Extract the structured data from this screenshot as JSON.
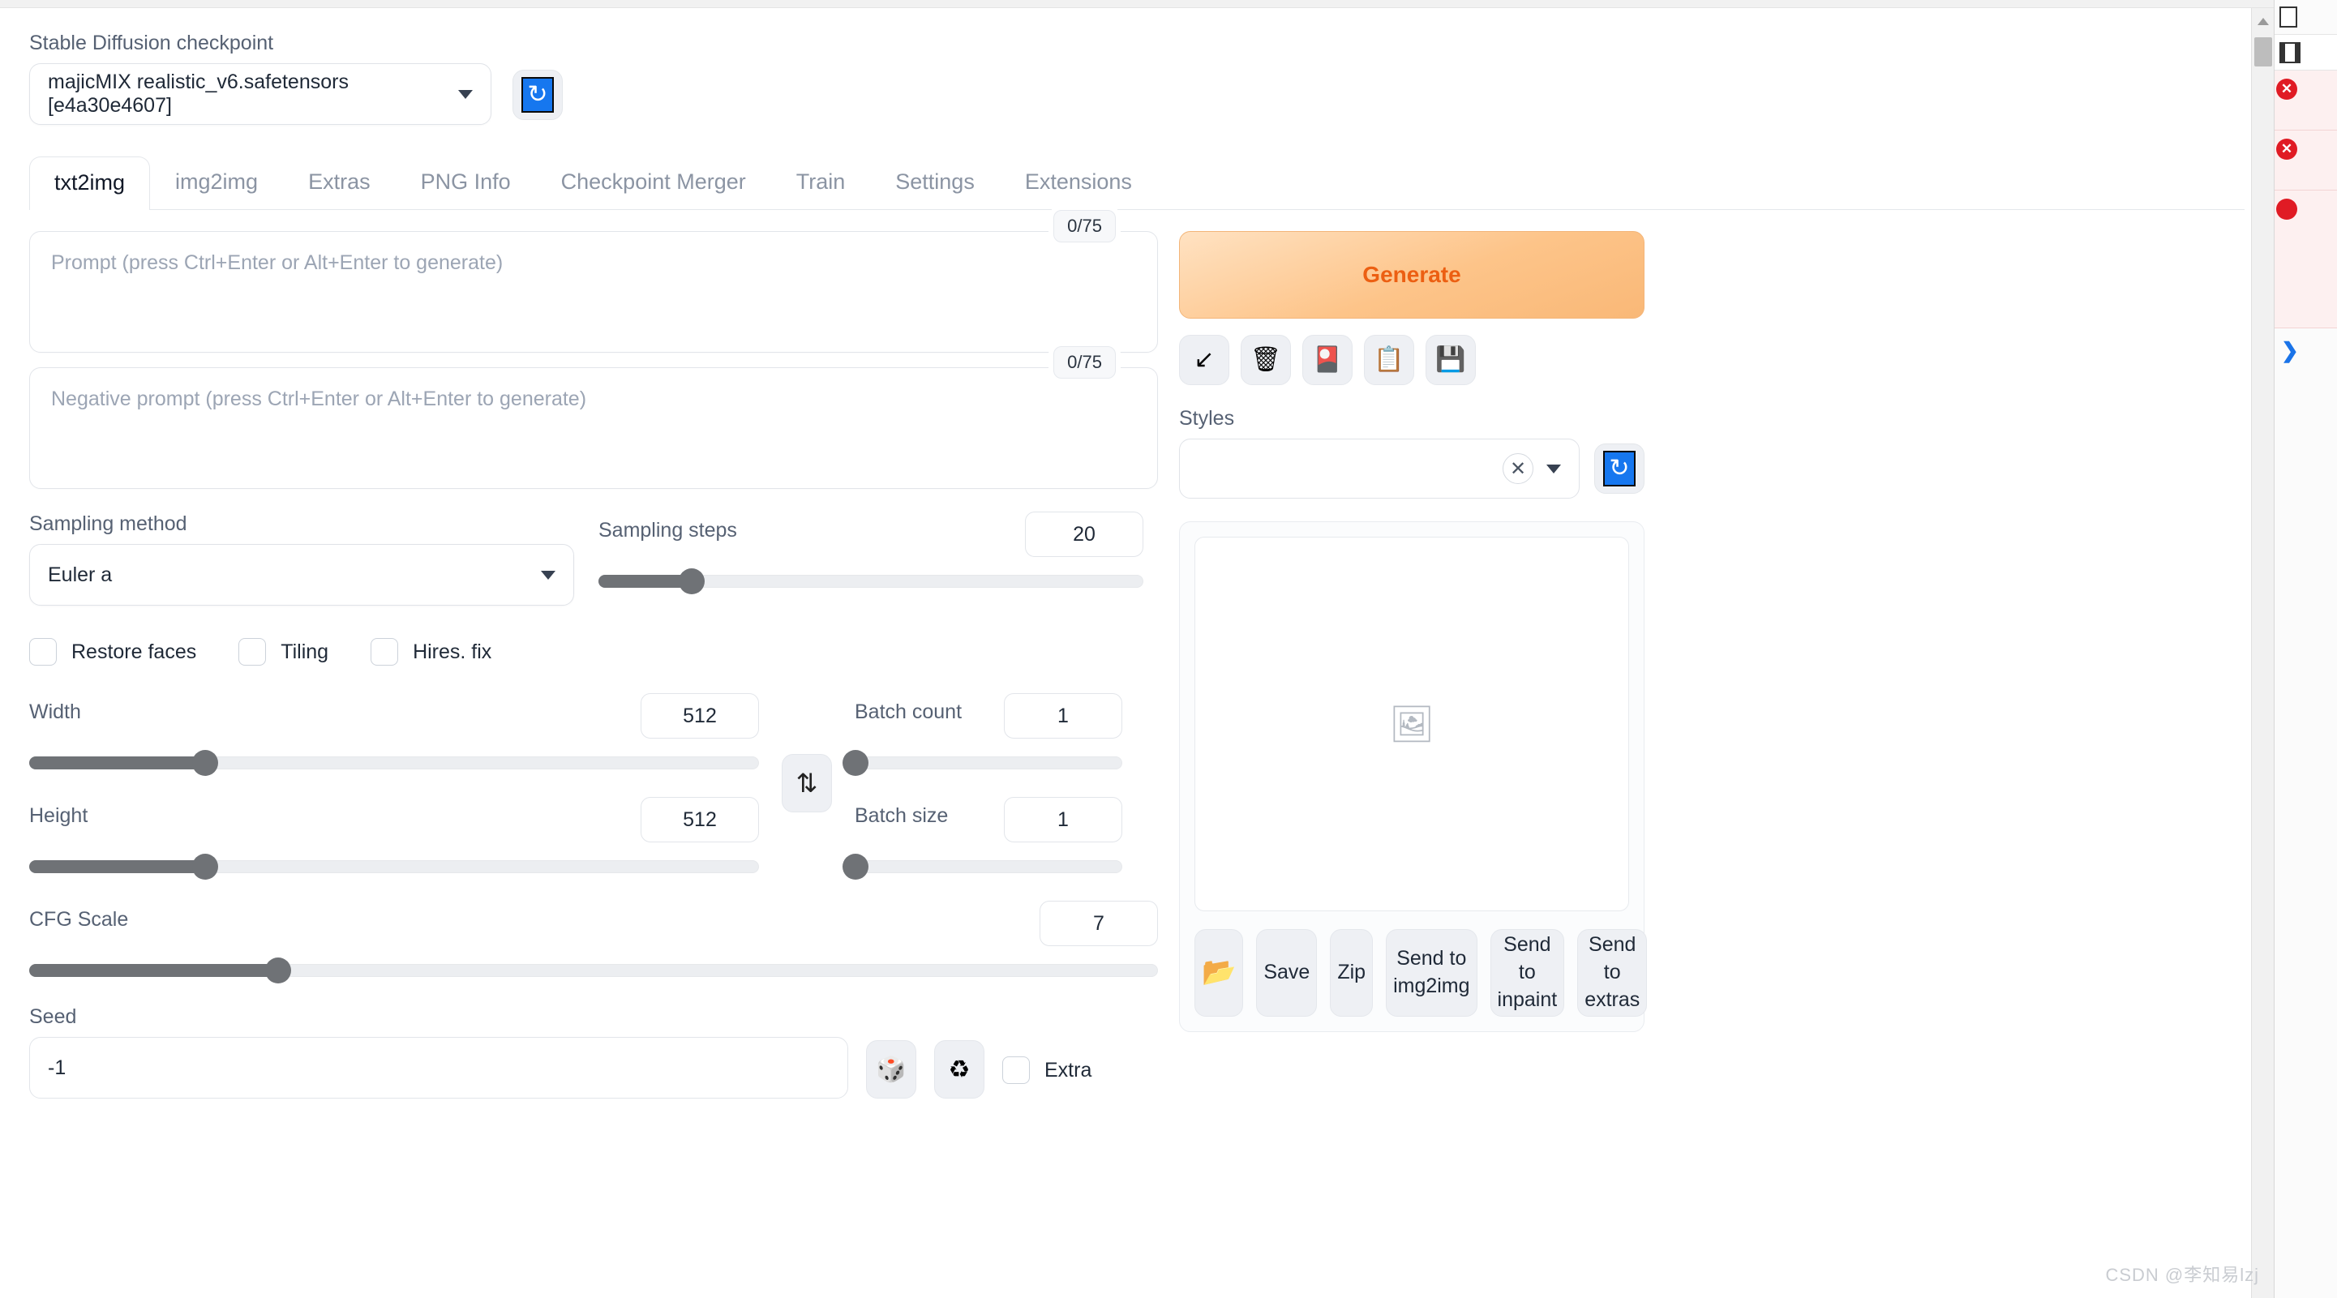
{
  "checkpoint": {
    "label": "Stable Diffusion checkpoint",
    "value": "majicMIX realistic_v6.safetensors [e4a30e4607]",
    "refresh_icon": "refresh-icon"
  },
  "tabs": [
    {
      "label": "txt2img",
      "active": true
    },
    {
      "label": "img2img",
      "active": false
    },
    {
      "label": "Extras",
      "active": false
    },
    {
      "label": "PNG Info",
      "active": false
    },
    {
      "label": "Checkpoint Merger",
      "active": false
    },
    {
      "label": "Train",
      "active": false
    },
    {
      "label": "Settings",
      "active": false
    },
    {
      "label": "Extensions",
      "active": false
    }
  ],
  "prompt": {
    "placeholder": "Prompt (press Ctrl+Enter or Alt+Enter to generate)",
    "value": "",
    "token_count": "0/75"
  },
  "negative_prompt": {
    "placeholder": "Negative prompt (press Ctrl+Enter or Alt+Enter to generate)",
    "value": "",
    "token_count": "0/75"
  },
  "generate": {
    "label": "Generate",
    "accent_color": "#ec5f12",
    "icon_buttons": [
      {
        "name": "restore-progress-icon",
        "glyph": "↙"
      },
      {
        "name": "trash-icon",
        "glyph": "🗑"
      },
      {
        "name": "extra-networks-icon",
        "glyph": "🎴"
      },
      {
        "name": "clipboard-icon",
        "glyph": "📋"
      },
      {
        "name": "save-style-icon",
        "glyph": "💾"
      }
    ]
  },
  "styles": {
    "label": "Styles",
    "value": "",
    "clear_glyph": "✕",
    "refresh_icon": "refresh-icon"
  },
  "sampling_method": {
    "label": "Sampling method",
    "value": "Euler a"
  },
  "sampling_steps": {
    "label": "Sampling steps",
    "value": "20",
    "fill_percent": 17
  },
  "toggles": [
    {
      "label": "Restore faces",
      "checked": false
    },
    {
      "label": "Tiling",
      "checked": false
    },
    {
      "label": "Hires. fix",
      "checked": false
    }
  ],
  "width": {
    "label": "Width",
    "value": "512",
    "fill_percent": 24
  },
  "height": {
    "label": "Height",
    "value": "512",
    "fill_percent": 24
  },
  "swap_button": {
    "name": "swap-dimensions-button",
    "glyph": "⇅"
  },
  "batch_count": {
    "label": "Batch count",
    "value": "1",
    "fill_percent": 0
  },
  "batch_size": {
    "label": "Batch size",
    "value": "1",
    "fill_percent": 0
  },
  "cfg_scale": {
    "label": "CFG Scale",
    "value": "7",
    "fill_percent": 22
  },
  "seed": {
    "label": "Seed",
    "value": "-1",
    "random_icon": "🎲",
    "recycle_icon": "♻",
    "extra_label": "Extra",
    "extra_checked": false
  },
  "output": {
    "placeholder_icon": "🖼",
    "actions": [
      {
        "name": "open-folder-button",
        "label": "📂",
        "icon_only": true
      },
      {
        "name": "save-button",
        "label": "Save",
        "icon_only": false
      },
      {
        "name": "zip-button",
        "label": "Zip",
        "icon_only": false
      },
      {
        "name": "send-to-img2img-button",
        "label": "Send to img2img",
        "icon_only": false
      },
      {
        "name": "send-to-inpaint-button",
        "label": "Send to inpaint",
        "icon_only": false
      },
      {
        "name": "send-to-extras-button",
        "label": "Send to extras",
        "icon_only": false
      }
    ]
  },
  "devtools": {
    "error_glyph": "✕",
    "prompt_glyph": "❯"
  },
  "watermark": "CSDN @李知易lzj"
}
